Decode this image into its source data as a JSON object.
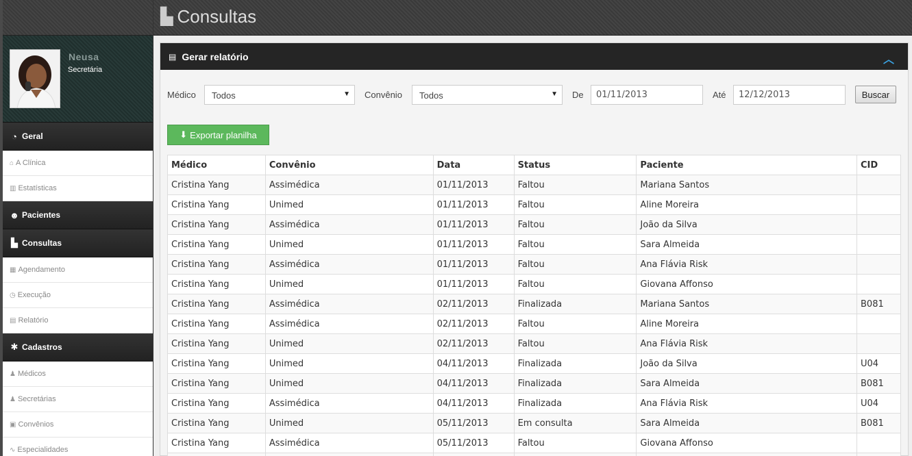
{
  "page": {
    "title": "Consultas"
  },
  "user": {
    "name": "Neusa",
    "role": "Secretária"
  },
  "sidebar": [
    {
      "type": "section",
      "label": "Geral",
      "icon": "dashboard-icon",
      "glyph": "◔"
    },
    {
      "type": "item",
      "label": "A Clínica",
      "icon": "home-icon",
      "glyph": "⌂"
    },
    {
      "type": "item",
      "label": "Estatísticas",
      "icon": "bar-chart-icon",
      "glyph": "▥"
    },
    {
      "type": "section",
      "label": "Pacientes",
      "icon": "users-icon",
      "glyph": "☻"
    },
    {
      "type": "section",
      "label": "Consultas",
      "icon": "copy-icon",
      "glyph": "▙"
    },
    {
      "type": "item",
      "label": "Agendamento",
      "icon": "calendar-icon",
      "glyph": "▦"
    },
    {
      "type": "item",
      "label": "Execução",
      "icon": "clock-icon",
      "glyph": "◷"
    },
    {
      "type": "item",
      "label": "Relatório",
      "icon": "file-icon",
      "glyph": "▤"
    },
    {
      "type": "section",
      "label": "Cadastros",
      "icon": "gear-icon",
      "glyph": "✱"
    },
    {
      "type": "item",
      "label": "Médicos",
      "icon": "user-md-icon",
      "glyph": "♟"
    },
    {
      "type": "item",
      "label": "Secretárias",
      "icon": "user-icon",
      "glyph": "♟"
    },
    {
      "type": "item",
      "label": "Convênios",
      "icon": "briefcase-icon",
      "glyph": "▣"
    },
    {
      "type": "item",
      "label": "Especialidades",
      "icon": "stethoscope-icon",
      "glyph": "∿"
    }
  ],
  "panel": {
    "title": "Gerar relatório",
    "filters": {
      "medico_label": "Médico",
      "medico_value": "Todos",
      "convenio_label": "Convênio",
      "convenio_value": "Todos",
      "de_label": "De",
      "de_value": "01/11/2013",
      "ate_label": "Até",
      "ate_value": "12/12/2013",
      "buscar_label": "Buscar"
    },
    "export_label": "Exportar planilha"
  },
  "table": {
    "columns": [
      "Médico",
      "Convênio",
      "Data",
      "Status",
      "Paciente",
      "CID"
    ],
    "rows": [
      [
        "Cristina Yang",
        "Assimédica",
        "01/11/2013",
        "Faltou",
        "Mariana Santos",
        ""
      ],
      [
        "Cristina Yang",
        "Unimed",
        "01/11/2013",
        "Faltou",
        "Aline Moreira",
        ""
      ],
      [
        "Cristina Yang",
        "Assimédica",
        "01/11/2013",
        "Faltou",
        "João da Silva",
        ""
      ],
      [
        "Cristina Yang",
        "Unimed",
        "01/11/2013",
        "Faltou",
        "Sara Almeida",
        ""
      ],
      [
        "Cristina Yang",
        "Assimédica",
        "01/11/2013",
        "Faltou",
        "Ana Flávia Risk",
        ""
      ],
      [
        "Cristina Yang",
        "Unimed",
        "01/11/2013",
        "Faltou",
        "Giovana Affonso",
        ""
      ],
      [
        "Cristina Yang",
        "Assimédica",
        "02/11/2013",
        "Finalizada",
        "Mariana Santos",
        "B081"
      ],
      [
        "Cristina Yang",
        "Assimédica",
        "02/11/2013",
        "Faltou",
        "Aline Moreira",
        ""
      ],
      [
        "Cristina Yang",
        "Unimed",
        "02/11/2013",
        "Faltou",
        "Ana Flávia Risk",
        ""
      ],
      [
        "Cristina Yang",
        "Unimed",
        "04/11/2013",
        "Finalizada",
        "João da Silva",
        "U04"
      ],
      [
        "Cristina Yang",
        "Unimed",
        "04/11/2013",
        "Finalizada",
        "Sara Almeida",
        "B081"
      ],
      [
        "Cristina Yang",
        "Assimédica",
        "04/11/2013",
        "Finalizada",
        "Ana Flávia Risk",
        "U04"
      ],
      [
        "Cristina Yang",
        "Unimed",
        "05/11/2013",
        "Em consulta",
        "Sara Almeida",
        "B081"
      ],
      [
        "Cristina Yang",
        "Assimédica",
        "05/11/2013",
        "Faltou",
        "Giovana Affonso",
        ""
      ],
      [
        "",
        "",
        "",
        "",
        "",
        ""
      ]
    ]
  }
}
